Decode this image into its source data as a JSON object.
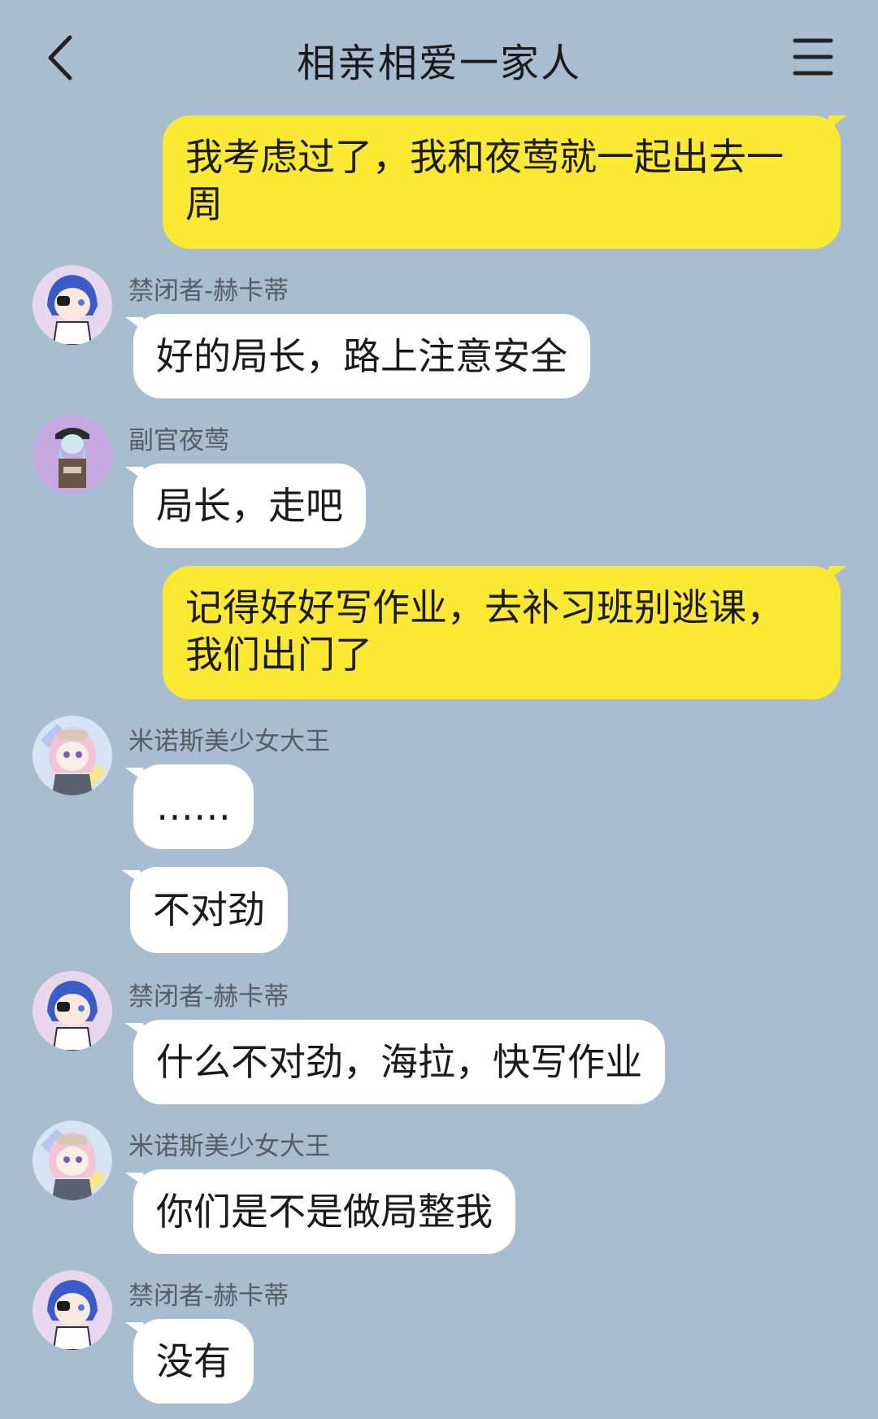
{
  "header": {
    "title": "相亲相爱一家人",
    "back_icon": "chevron-left-icon",
    "menu_icon": "hamburger-menu-icon"
  },
  "colors": {
    "background": "#a9bdd1",
    "bubble_out": "#fce934",
    "bubble_in": "#ffffff"
  },
  "messages": [
    {
      "type": "out",
      "text": "我考虑过了，我和夜莺就一起出去一周"
    },
    {
      "type": "in",
      "sender": "禁闭者-赫卡蒂",
      "text": "好的局长，路上注意安全"
    },
    {
      "type": "in",
      "sender": "副官夜莺",
      "text": "局长，走吧"
    },
    {
      "type": "out",
      "text": "记得好好写作业，去补习班别逃课，我们出门了"
    },
    {
      "type": "in",
      "sender": "米诺斯美少女大王",
      "text": "……"
    },
    {
      "type": "in",
      "text": "不对劲"
    },
    {
      "type": "in",
      "sender": "禁闭者-赫卡蒂",
      "text": "什么不对劲，海拉，快写作业"
    },
    {
      "type": "in",
      "sender": "米诺斯美少女大王",
      "text": "你们是不是做局整我"
    },
    {
      "type": "in",
      "sender": "禁闭者-赫卡蒂",
      "text": "没有"
    }
  ]
}
